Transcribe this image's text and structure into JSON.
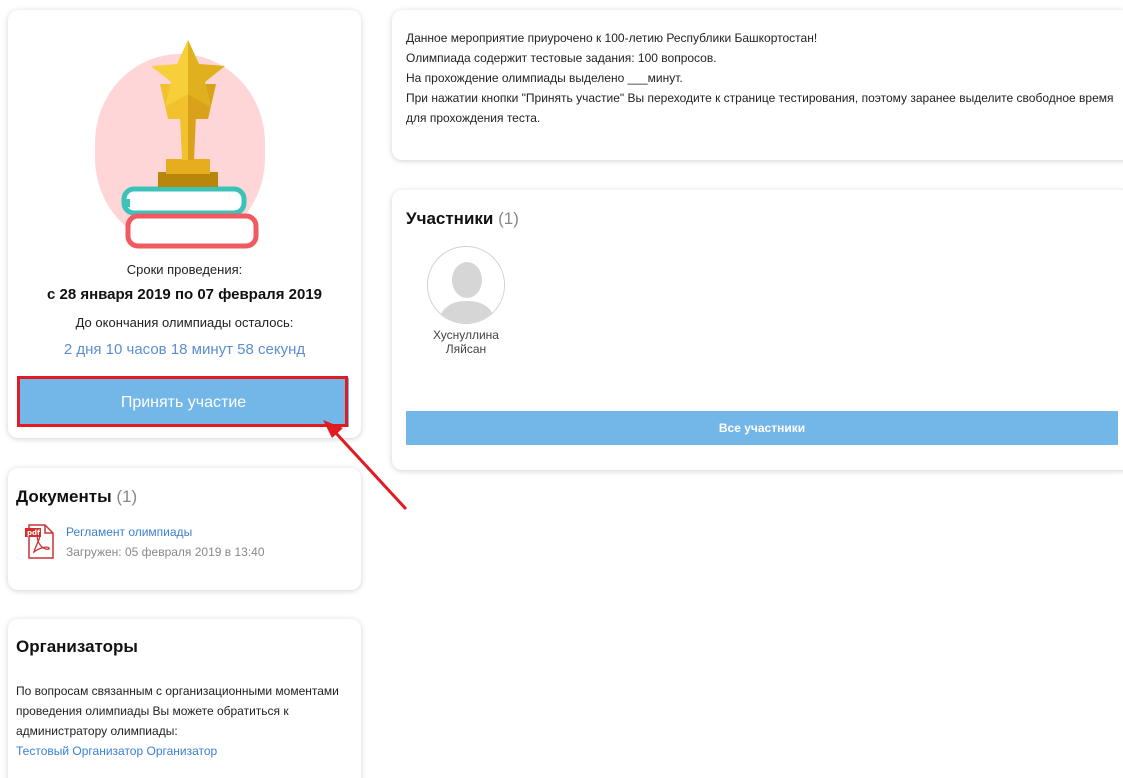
{
  "olympiad": {
    "dates_label": "Сроки проведения:",
    "dates_value": "с 28 января 2019 по 07 февраля 2019",
    "remaining_label": "До окончания олимпиады осталось:",
    "remaining_value": "2 дня 10 часов 18 минут 58 секунд",
    "join_button": "Принять участие"
  },
  "documents": {
    "title": "Документы",
    "count": "(1)",
    "items": [
      {
        "name": "Регламент олимпиады",
        "uploaded": "Загружен: 05 февраля 2019 в 13:40"
      }
    ]
  },
  "organizers": {
    "title": "Организаторы",
    "text": "По вопросам связанным с организационными моментами проведения олимпиады Вы можете обратиться к администратору олимпиады:",
    "link": "Тестовый Организатор Организатор"
  },
  "info": {
    "lines": [
      "Данное мероприятие приурочено к 100-летию Республики Башкортостан!",
      "Олимпиада содержит тестовые задания: 100 вопросов.",
      "На прохождение олимпиады выделено ___минут.",
      "При нажатии кнопки \"Принять участие\" Вы переходите к странице тестирования, поэтому заранее выделите свободное время для прохождения теста."
    ]
  },
  "participants": {
    "title": "Участники",
    "count": "(1)",
    "items": [
      {
        "first": "Хуснуллина",
        "last": "Ляйсан"
      }
    ],
    "all_button": "Все участники"
  },
  "colors": {
    "accent": "#73b6e8",
    "link": "#3a7fd5",
    "highlight": "#e11b22",
    "hero_bg": "#ffd6d8"
  }
}
